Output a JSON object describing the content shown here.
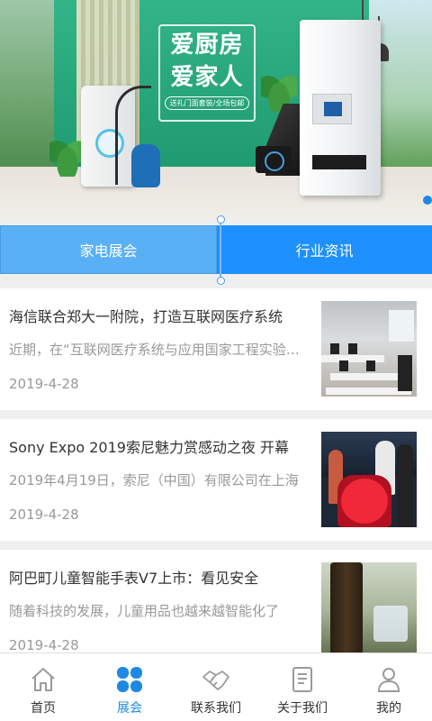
{
  "banner": {
    "headline_line1": "爱厨房",
    "headline_line2": "爱家人",
    "tagline": "送礼门面套装/全场包邮",
    "slide_count_visible": 1
  },
  "tabs": [
    {
      "label": "家电展会",
      "active": true
    },
    {
      "label": "行业资讯",
      "active": false
    }
  ],
  "news": [
    {
      "title": "海信联合郑大一附院，打造互联网医疗系统",
      "summary": "近期，在“互联网医疗系统与应用国家工程实验室”",
      "date": "2019-4-28",
      "thumb": "office-photo"
    },
    {
      "title": "Sony Expo 2019索尼魅力赏感动之夜 开幕",
      "summary": "2019年4月19日，索尼（中国）有限公司在上海",
      "date": "2019-4-28",
      "thumb": "event-photo"
    },
    {
      "title": "阿巴町儿童智能手表V7上市：看见安全",
      "summary": "随着科技的发展，儿童用品也越来越智能化了",
      "date": "2019-4-28",
      "thumb": "watch-photo"
    }
  ],
  "bottom_nav": [
    {
      "label": "首页",
      "icon": "home-icon",
      "active": false
    },
    {
      "label": "展会",
      "icon": "clover-icon",
      "active": true
    },
    {
      "label": "联系我们",
      "icon": "handshake-icon",
      "active": false
    },
    {
      "label": "关于我们",
      "icon": "document-icon",
      "active": false
    },
    {
      "label": "我的",
      "icon": "user-icon",
      "active": false
    }
  ],
  "colors": {
    "primary": "#1e90ff",
    "active_tab": "#5ab0f5",
    "nav_active": "#1e88e5",
    "text": "#333333",
    "muted": "#999999"
  }
}
